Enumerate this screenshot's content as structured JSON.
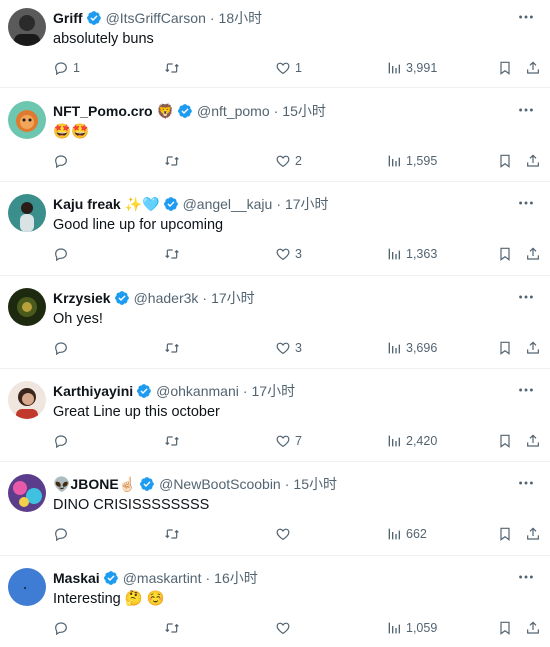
{
  "tweets": [
    {
      "name": "Griff",
      "name_emoji": "",
      "handle": "@ItsGriffCarson",
      "time": "18小时",
      "text": "absolutely buns",
      "replies": "1",
      "retweets": "",
      "likes": "1",
      "views": "3,991",
      "avatar_color": "#2b2b2b"
    },
    {
      "name": "NFT_Pomo.cro",
      "name_emoji": "🦁",
      "handle": "@nft_pomo",
      "time": "15小时",
      "text": "🤩🤩",
      "replies": "",
      "retweets": "",
      "likes": "2",
      "views": "1,595",
      "avatar_color": "#6cc6b0"
    },
    {
      "name": "Kaju freak",
      "name_emoji": "✨🩵",
      "handle": "@angel__kaju",
      "time": "17小时",
      "text": "Good line up for upcoming",
      "replies": "",
      "retweets": "",
      "likes": "3",
      "views": "1,363",
      "avatar_color": "#3a8f8c"
    },
    {
      "name": "Krzysiek",
      "name_emoji": "",
      "handle": "@hader3k",
      "time": "17小时",
      "text": "Oh yes!",
      "replies": "",
      "retweets": "",
      "likes": "3",
      "views": "3,696",
      "avatar_color": "#1e2a10"
    },
    {
      "name": "Karthiyayini",
      "name_emoji": "",
      "handle": "@ohkanmani",
      "time": "17小时",
      "text": "Great Line up this october",
      "replies": "",
      "retweets": "",
      "likes": "7",
      "views": "2,420",
      "avatar_color": "#d9b9a8"
    },
    {
      "name": "👽JBONE☝🏻",
      "name_emoji": "",
      "handle": "@NewBootScoobin",
      "time": "15小时",
      "text": "DINO CRISISSSSSSSS",
      "replies": "",
      "retweets": "",
      "likes": "",
      "views": "662",
      "avatar_color": "#5b3d8c"
    },
    {
      "name": "Maskai",
      "name_emoji": "",
      "handle": "@maskartint",
      "time": "16小时",
      "text": "Interesting 🤔 ☺️",
      "replies": "",
      "retweets": "",
      "likes": "",
      "views": "1,059",
      "avatar_color": "#3f7dd4"
    }
  ],
  "colors": {
    "verified": "#1d9bf0",
    "secondary_text": "#536471",
    "divider": "#eff3f4"
  },
  "icons": {
    "more": "more-icon",
    "reply": "reply-icon",
    "retweet": "retweet-icon",
    "like": "heart-icon",
    "views": "views-icon",
    "bookmark": "bookmark-icon",
    "share": "share-icon",
    "verified": "verified-badge-icon"
  }
}
